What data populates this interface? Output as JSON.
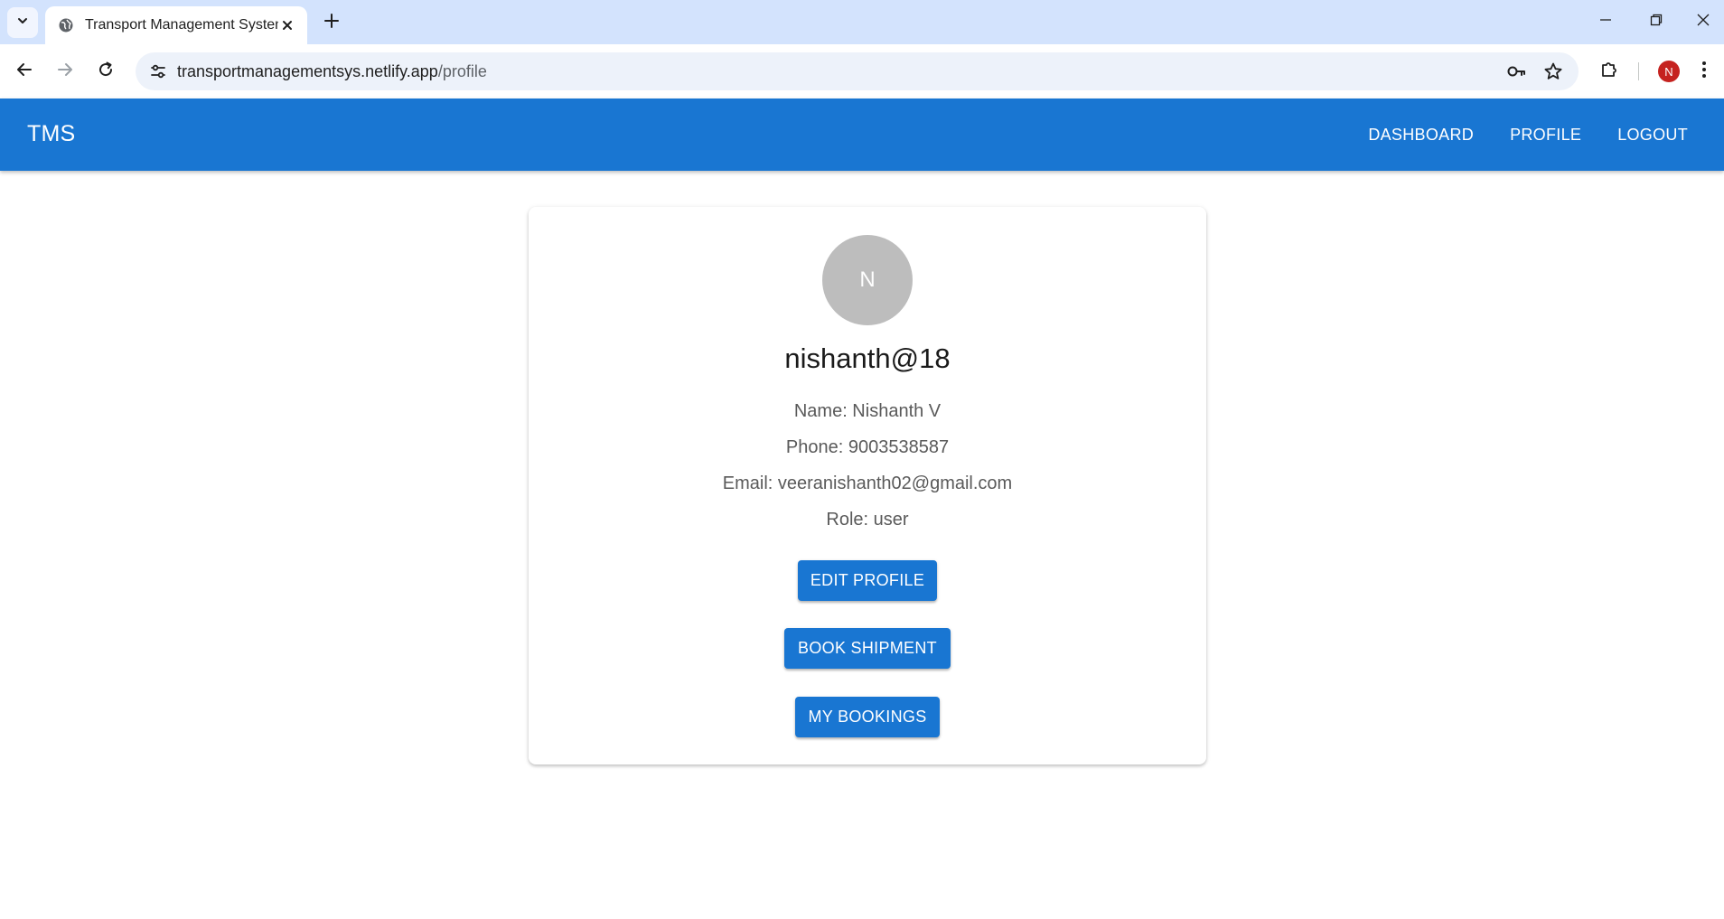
{
  "browser": {
    "tab_title": "Transport Management System",
    "url_host": "transportmanagementsys.netlify.app",
    "url_path": "/profile",
    "profile_initial": "N",
    "icons": {
      "tab_search": "chevron-down-icon",
      "favicon": "globe-icon",
      "tab_close": "close-icon",
      "new_tab": "plus-icon",
      "back": "arrow-left-icon",
      "forward": "arrow-right-icon",
      "reload": "reload-icon",
      "site_info": "tune-icon",
      "password": "key-icon",
      "bookmark": "star-icon",
      "extensions": "puzzle-icon",
      "menu": "kebab-menu-icon"
    }
  },
  "appbar": {
    "brand": "TMS",
    "nav": [
      "DASHBOARD",
      "PROFILE",
      "LOGOUT"
    ],
    "color": "#1976d2"
  },
  "profile": {
    "avatar_initial": "N",
    "username": "nishanth@18",
    "name_line": "Name: Nishanth V",
    "phone_line": "Phone: 9003538587",
    "email_line": "Email: veeranishanth02@gmail.com",
    "role_line": "Role: user",
    "buttons": {
      "edit": "EDIT PROFILE",
      "book": "BOOK SHIPMENT",
      "bookings": "MY BOOKINGS"
    }
  }
}
